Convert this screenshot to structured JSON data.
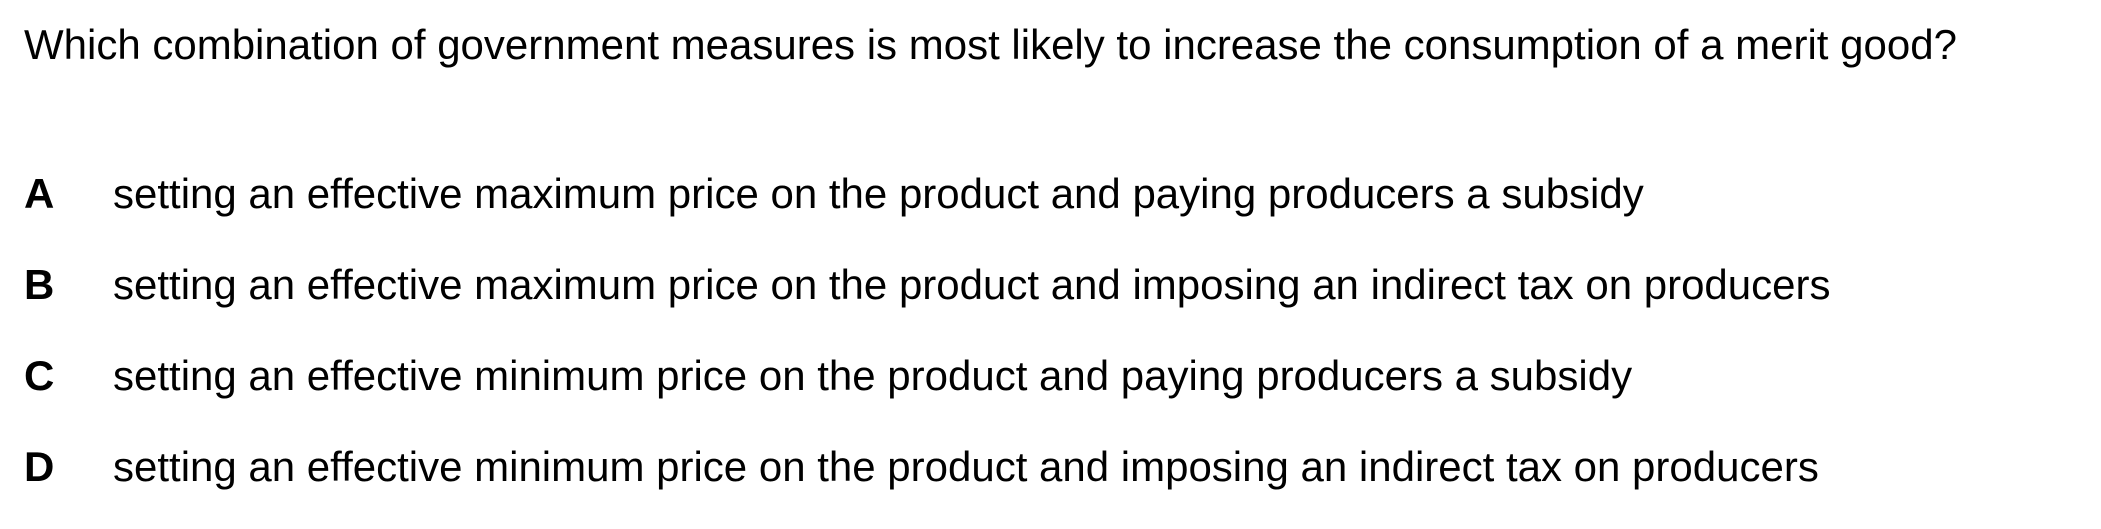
{
  "question": {
    "text": "Which combination of government measures is most likely to increase the consumption of a merit good?"
  },
  "options": [
    {
      "letter": "A",
      "text": "setting an effective maximum price on the product and paying producers a subsidy"
    },
    {
      "letter": "B",
      "text": "setting an effective maximum price on the product and imposing an indirect tax on producers"
    },
    {
      "letter": "C",
      "text": "setting an effective minimum price on the product and paying producers a subsidy"
    },
    {
      "letter": "D",
      "text": "setting an effective minimum price on the product and imposing an indirect tax on producers"
    }
  ]
}
